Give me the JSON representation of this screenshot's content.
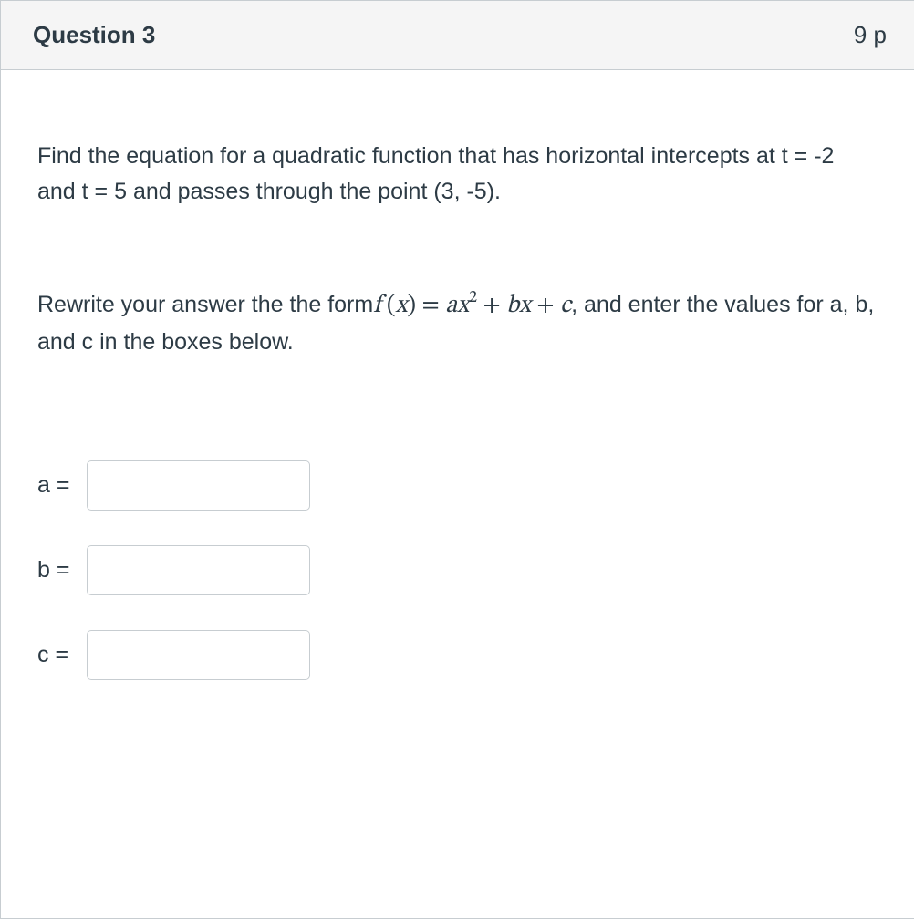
{
  "header": {
    "title": "Question 3",
    "points": "9 p"
  },
  "body": {
    "paragraph1": "Find the equation for a quadratic function that has horizontal intercepts at t = -2 and t = 5 and passes through the point (3, -5).",
    "paragraph2_pre": "Rewrite your answer the the form",
    "paragraph2_post": ", and enter the values for a, b, and c in the boxes below.",
    "formula": {
      "f": "f",
      "open": " (",
      "x": "x",
      "close": ")",
      "eq": "  =  ",
      "a": "a",
      "x2": "x",
      "sup2": "2",
      "plus1": "  +  ",
      "b": "b",
      "x3": "x",
      "plus2": "  +  ",
      "c": "c"
    }
  },
  "answers": {
    "a": {
      "label": "a = ",
      "value": ""
    },
    "b": {
      "label": "b = ",
      "value": ""
    },
    "c": {
      "label": "c = ",
      "value": ""
    }
  }
}
